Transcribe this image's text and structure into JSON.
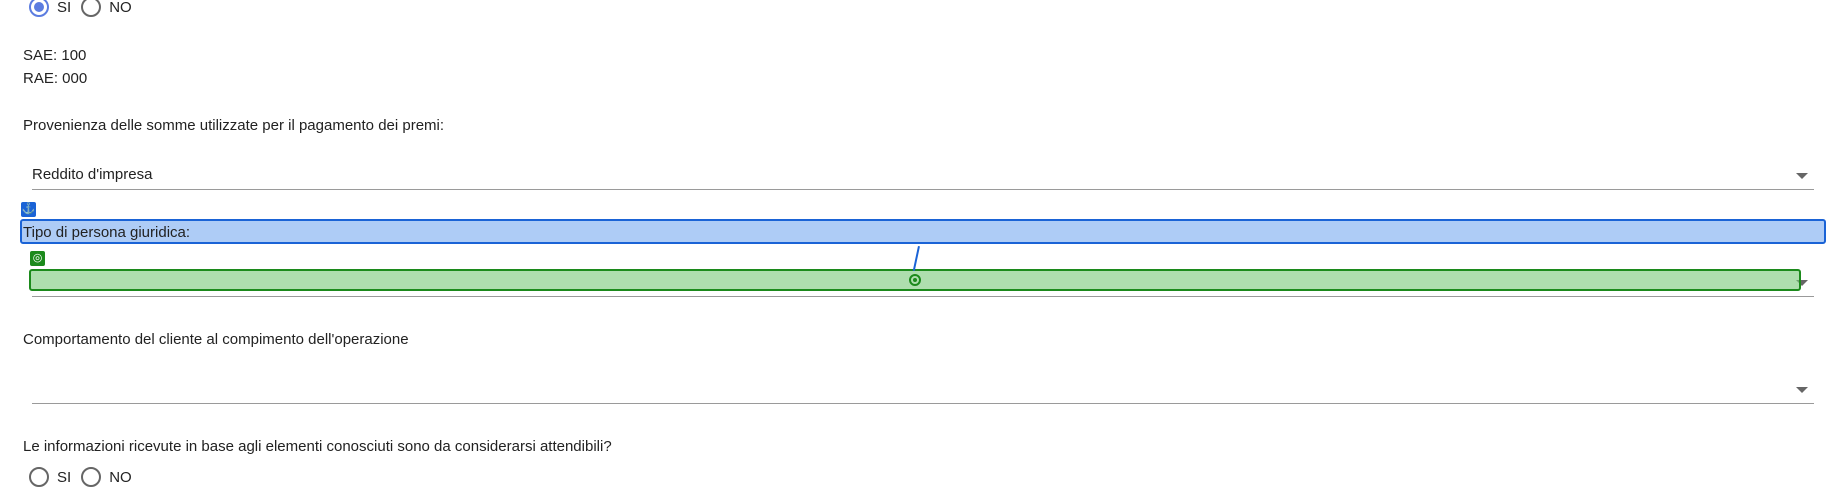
{
  "radio_top": {
    "options": [
      "SI",
      "NO"
    ],
    "selected": "SI"
  },
  "codes": {
    "sae": "SAE: 100",
    "rae": "RAE: 000"
  },
  "provenienza": {
    "label": "Provenienza delle somme utilizzate per il pagamento dei premi:",
    "value": "Reddito d'impresa"
  },
  "tipo_persona": {
    "label": "Tipo di persona giuridica:",
    "value": ""
  },
  "comportamento": {
    "label": "Comportamento del cliente al compimento dell'operazione",
    "value": ""
  },
  "informazioni": {
    "label": "Le informazioni ricevute in base agli elementi conosciuti sono da considerarsi attendibili?",
    "options": [
      "SI",
      "NO"
    ],
    "selected": ""
  },
  "overlay": {
    "anchor_icon": "anchor-icon",
    "target_icon": "target-icon",
    "colors": {
      "anchor": "#1a63d6",
      "target": "#1c8a1c"
    }
  }
}
